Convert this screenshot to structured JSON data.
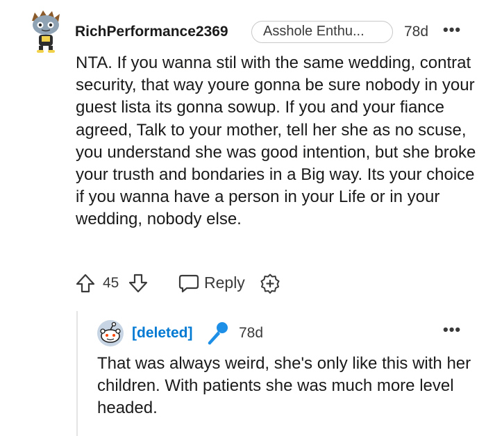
{
  "comment": {
    "username": "RichPerformance2369",
    "flair": "Asshole Enthu...",
    "age": "78d",
    "more": "•••",
    "body": "NTA. If you wanna stil with the same wedding, contrat security, that way youre gonna be sure nobody in your guest lista its gonna sowup. If you and your fiance agreed, Talk to your mother, tell her she as no scuse, you understand she was good intention, but she broke your trusth and bondaries in a Big way. Its your choice if you wanna have a person in your Life or in your wedding, nobody else.",
    "actions": {
      "upvote_icon": "upvote-arrow-icon",
      "score": "45",
      "downvote_icon": "downvote-arrow-icon",
      "reply_icon": "speech-bubble-icon",
      "reply_label": "Reply",
      "award_icon": "award-plus-icon"
    }
  },
  "reply": {
    "username": "[deleted]",
    "badge_icon": "microphone-icon",
    "age": "78d",
    "more": "•••",
    "body": "That was always weird, she's only like this with her children. With patients she was much more level headed."
  },
  "colors": {
    "deleted_user": "#0079d3",
    "text": "#1a1a1b",
    "muted": "#3a3a3a",
    "thread_line": "#e4e4e4"
  }
}
